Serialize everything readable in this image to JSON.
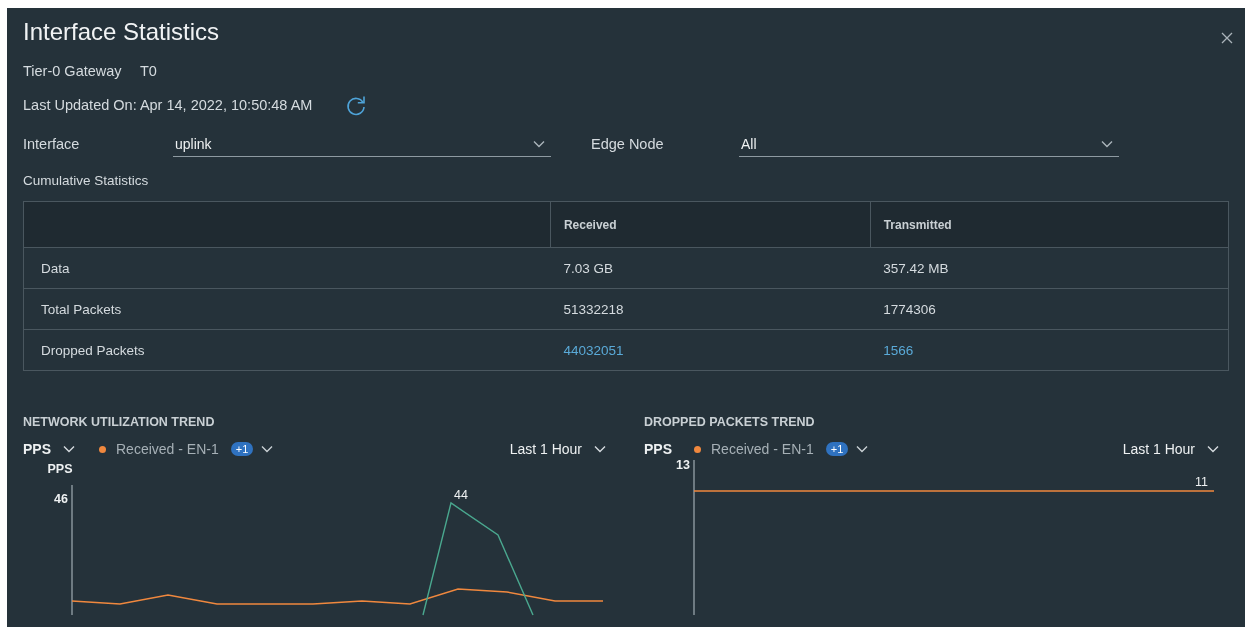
{
  "dialog": {
    "title": "Interface Statistics",
    "gateway": {
      "label": "Tier-0 Gateway",
      "value": "T0"
    },
    "last_updated": "Last Updated On: Apr 14, 2022, 10:50:48 AM",
    "selects": [
      {
        "label": "Interface",
        "value": "uplink"
      },
      {
        "label": "Edge Node",
        "value": "All"
      }
    ],
    "section_title": "Cumulative Statistics",
    "table": {
      "columns": [
        "Received",
        "Transmitted"
      ],
      "rows": [
        {
          "label": "Data",
          "cells": [
            {
              "text": "7.03 GB",
              "kind": "text"
            },
            {
              "text": "357.42 MB",
              "kind": "text"
            }
          ]
        },
        {
          "label": "Total Packets",
          "cells": [
            {
              "text": "51332218",
              "kind": "text"
            },
            {
              "text": "1774306",
              "kind": "text"
            }
          ]
        },
        {
          "label": "Dropped Packets",
          "cells": [
            {
              "text": "44032051",
              "kind": "link"
            },
            {
              "text": "1566",
              "kind": "link"
            }
          ]
        }
      ]
    },
    "charts": [
      {
        "kind": "spike",
        "title": "NETWORK UTILIZATION TREND",
        "metric": "PPS",
        "metric_dropdown": true,
        "legend": {
          "series": "Received - EN-1",
          "color": "#f0883e",
          "more": "+1"
        },
        "range": "Last 1 Hour",
        "axis_title": "PPS",
        "axis_label": "46",
        "value_label": "44"
      },
      {
        "kind": "flat",
        "title": "DROPPED PACKETS TREND",
        "metric": "PPS",
        "metric_dropdown": false,
        "legend": {
          "series": "Received - EN-1",
          "color": "#f0883e",
          "more": "+1"
        },
        "range": "Last 1 Hour",
        "axis_label": "13",
        "value_label": "11"
      }
    ]
  }
}
